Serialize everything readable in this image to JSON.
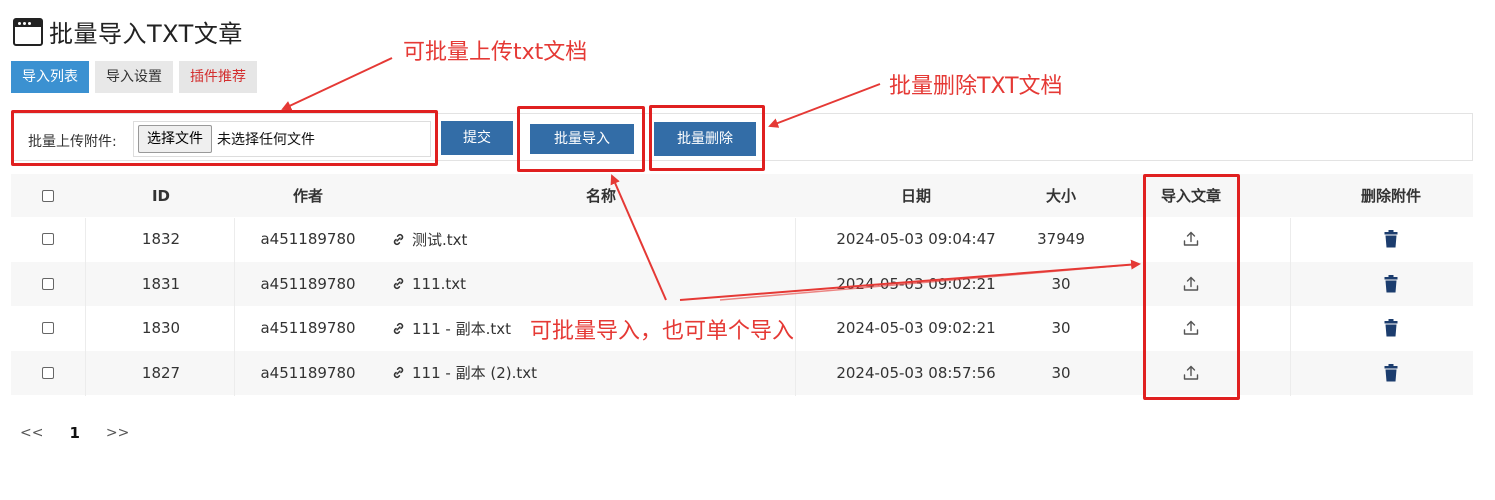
{
  "header": {
    "title": "批量导入TXT文章"
  },
  "tabs": [
    {
      "label": "导入列表",
      "active": true
    },
    {
      "label": "导入设置",
      "active": false
    },
    {
      "label": "插件推荐",
      "active": false
    }
  ],
  "upload": {
    "label": "批量上传附件:",
    "choose_button": "选择文件",
    "no_file_text": "未选择任何文件",
    "submit_button": "提交",
    "batch_import_button": "批量导入",
    "batch_delete_button": "批量删除"
  },
  "table": {
    "columns": {
      "id": "ID",
      "author": "作者",
      "name": "名称",
      "date": "日期",
      "size": "大小",
      "import": "导入文章",
      "delete": "删除附件"
    },
    "rows": [
      {
        "id": "1832",
        "author": "a451189780",
        "name": "测试.txt",
        "date": "2024-05-03 09:04:47",
        "size": "37949"
      },
      {
        "id": "1831",
        "author": "a451189780",
        "name": "111.txt",
        "date": "2024-05-03 09:02:21",
        "size": "30"
      },
      {
        "id": "1830",
        "author": "a451189780",
        "name": "111 - 副本.txt",
        "date": "2024-05-03 09:02:21",
        "size": "30"
      },
      {
        "id": "1827",
        "author": "a451189780",
        "name": "111 - 副本 (2).txt",
        "date": "2024-05-03 08:57:56",
        "size": "30"
      }
    ]
  },
  "pagination": {
    "prev": "<<",
    "current": "1",
    "next": ">>"
  },
  "annotations": {
    "upload_note": "可批量上传txt文档",
    "delete_note": "批量删除TXT文档",
    "import_note": "可批量导入，也可单个导入"
  },
  "colors": {
    "accent": "#3b91d1",
    "button": "#336da7",
    "annotation": "#e53935",
    "trash": "#1c3d6e"
  },
  "icons": {
    "link": "link-icon",
    "upload": "upload-icon",
    "trash": "trash-icon",
    "window": "window-icon"
  }
}
